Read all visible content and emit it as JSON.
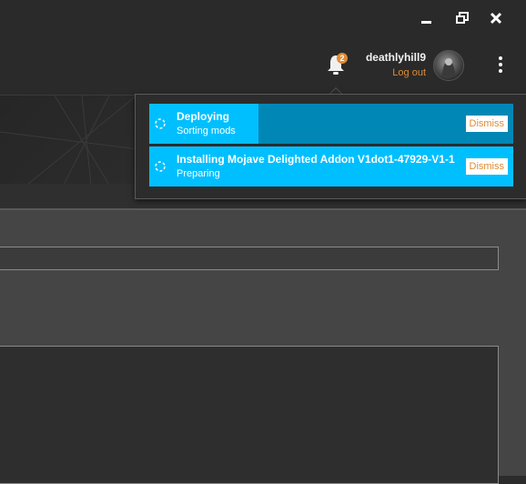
{
  "window": {
    "minimize_icon": "minimize-icon",
    "restore_icon": "restore-icon",
    "close_icon": "close-icon"
  },
  "user": {
    "name": "deathlyhill9",
    "logout_label": "Log out"
  },
  "notifications": {
    "count": "2",
    "items": [
      {
        "title": "Deploying",
        "subtitle": "Sorting mods",
        "progress": 0.3,
        "dismiss_label": "Dismiss"
      },
      {
        "title": "Installing Mojave Delighted Addon V1dot1-47929-V1-1",
        "subtitle": "Preparing",
        "progress": 1.0,
        "dismiss_label": "Dismiss"
      }
    ]
  },
  "colors": {
    "accent": "#e08a33",
    "progress_fill": "#00bfff",
    "progress_track": "#0087b5"
  }
}
